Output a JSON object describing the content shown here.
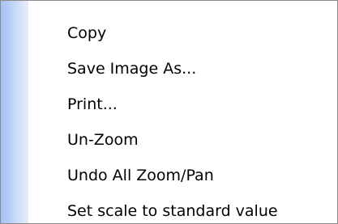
{
  "context_menu": {
    "items": [
      {
        "label": "Copy"
      },
      {
        "label": "Save Image As..."
      },
      {
        "label": "Print..."
      },
      {
        "label": "Un-Zoom"
      },
      {
        "label": "Undo All Zoom/Pan"
      },
      {
        "label": "Set scale to standard value"
      }
    ]
  },
  "colors": {
    "gutter_start": "#a3c1f2",
    "gutter_end": "#e6eefb",
    "border": "#8a8a8a",
    "background": "#ffffff",
    "text": "#000000"
  }
}
